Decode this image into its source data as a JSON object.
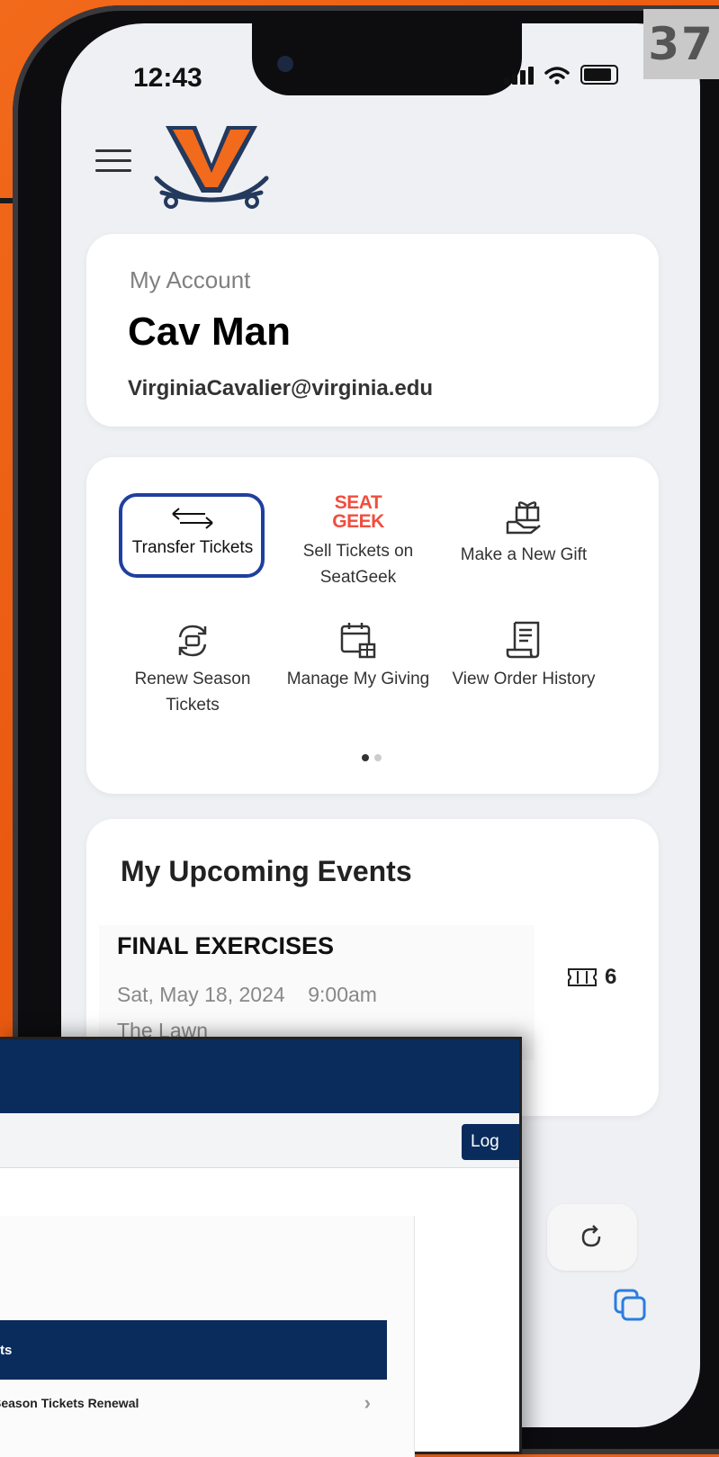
{
  "page_badge": "37",
  "status_bar": {
    "time": "12:43"
  },
  "account": {
    "label": "My Account",
    "name": "Cav Man",
    "email": "VirginiaCavalier@virginia.edu"
  },
  "actions": [
    {
      "label": "Transfer Tickets",
      "icon": "transfer-arrows-icon"
    },
    {
      "label": "Sell Tickets on SeatGeek",
      "icon": "seatgeek-logo",
      "logo_text_1": "SEAT",
      "logo_text_2": "GEEK"
    },
    {
      "label": "Make a New Gift",
      "icon": "gift-icon"
    },
    {
      "label": "Renew Season Tickets",
      "icon": "renew-ticket-icon"
    },
    {
      "label": "Manage My Giving",
      "icon": "calendar-gift-icon"
    },
    {
      "label": "View Order History",
      "icon": "receipt-icon"
    }
  ],
  "events": {
    "title": "My Upcoming Events",
    "items": [
      {
        "name": "FINAL EXERCISES",
        "date": "Sat, May 18, 2024",
        "time": "9:00am",
        "venue": "The Lawn",
        "tickets": "6"
      }
    ]
  },
  "overlay": {
    "login_label": "Log",
    "section_label": "ts",
    "row_label": "Season Tickets Renewal"
  },
  "colors": {
    "brand_orange": "#f26a1b",
    "brand_navy": "#0a2c5c",
    "highlight_blue": "#1f3fa0"
  }
}
